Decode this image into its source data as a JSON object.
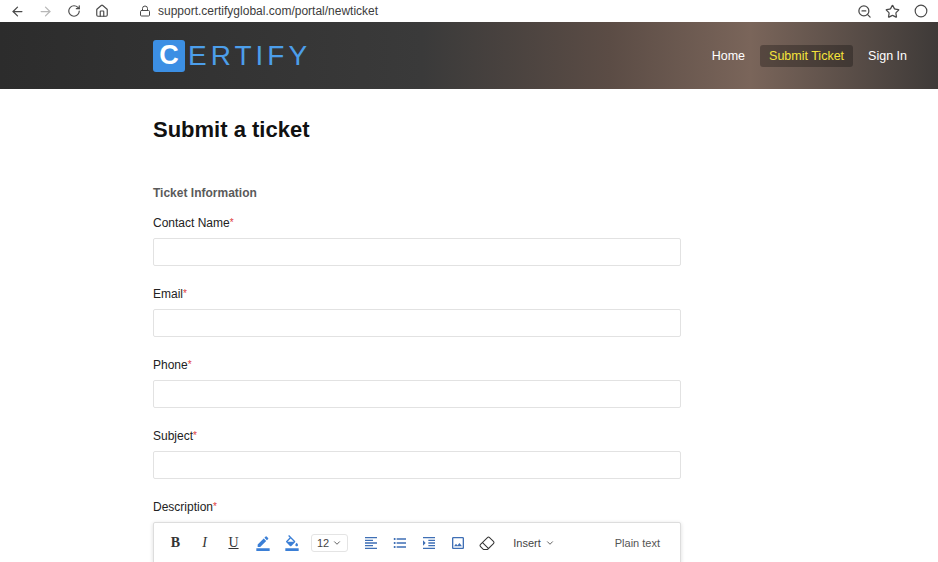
{
  "browser": {
    "back": {
      "disabled": false
    },
    "forward": {
      "disabled": true
    },
    "url": "support.certifyglobal.com/portal/newticket"
  },
  "header": {
    "logo": {
      "mark": "C",
      "rest": "ERTIFY"
    },
    "nav": [
      {
        "label": "Home",
        "selected": false
      },
      {
        "label": "Submit Ticket",
        "selected": true
      },
      {
        "label": "Sign In",
        "selected": false
      }
    ]
  },
  "page": {
    "title": "Submit a ticket",
    "section": "Ticket Information",
    "required_mark": "*"
  },
  "fields": [
    {
      "label": "Contact Name",
      "required": true,
      "value": ""
    },
    {
      "label": "Email",
      "required": true,
      "value": ""
    },
    {
      "label": "Phone",
      "required": true,
      "value": ""
    },
    {
      "label": "Subject",
      "required": true,
      "value": ""
    }
  ],
  "description": {
    "label": "Description",
    "required": true,
    "toolbar": [
      {
        "kind": "text",
        "label": "B"
      },
      {
        "kind": "text",
        "label": "I"
      },
      {
        "kind": "text",
        "label": "U"
      },
      {
        "kind": "icon"
      },
      {
        "kind": "icon"
      },
      {
        "kind": "dropdown",
        "label": "12"
      },
      {
        "kind": "icon"
      },
      {
        "kind": "icon"
      },
      {
        "kind": "icon"
      },
      {
        "kind": "icon"
      },
      {
        "kind": "icon"
      },
      {
        "kind": "menu",
        "label": "Insert"
      }
    ],
    "mode": "Plain text"
  }
}
